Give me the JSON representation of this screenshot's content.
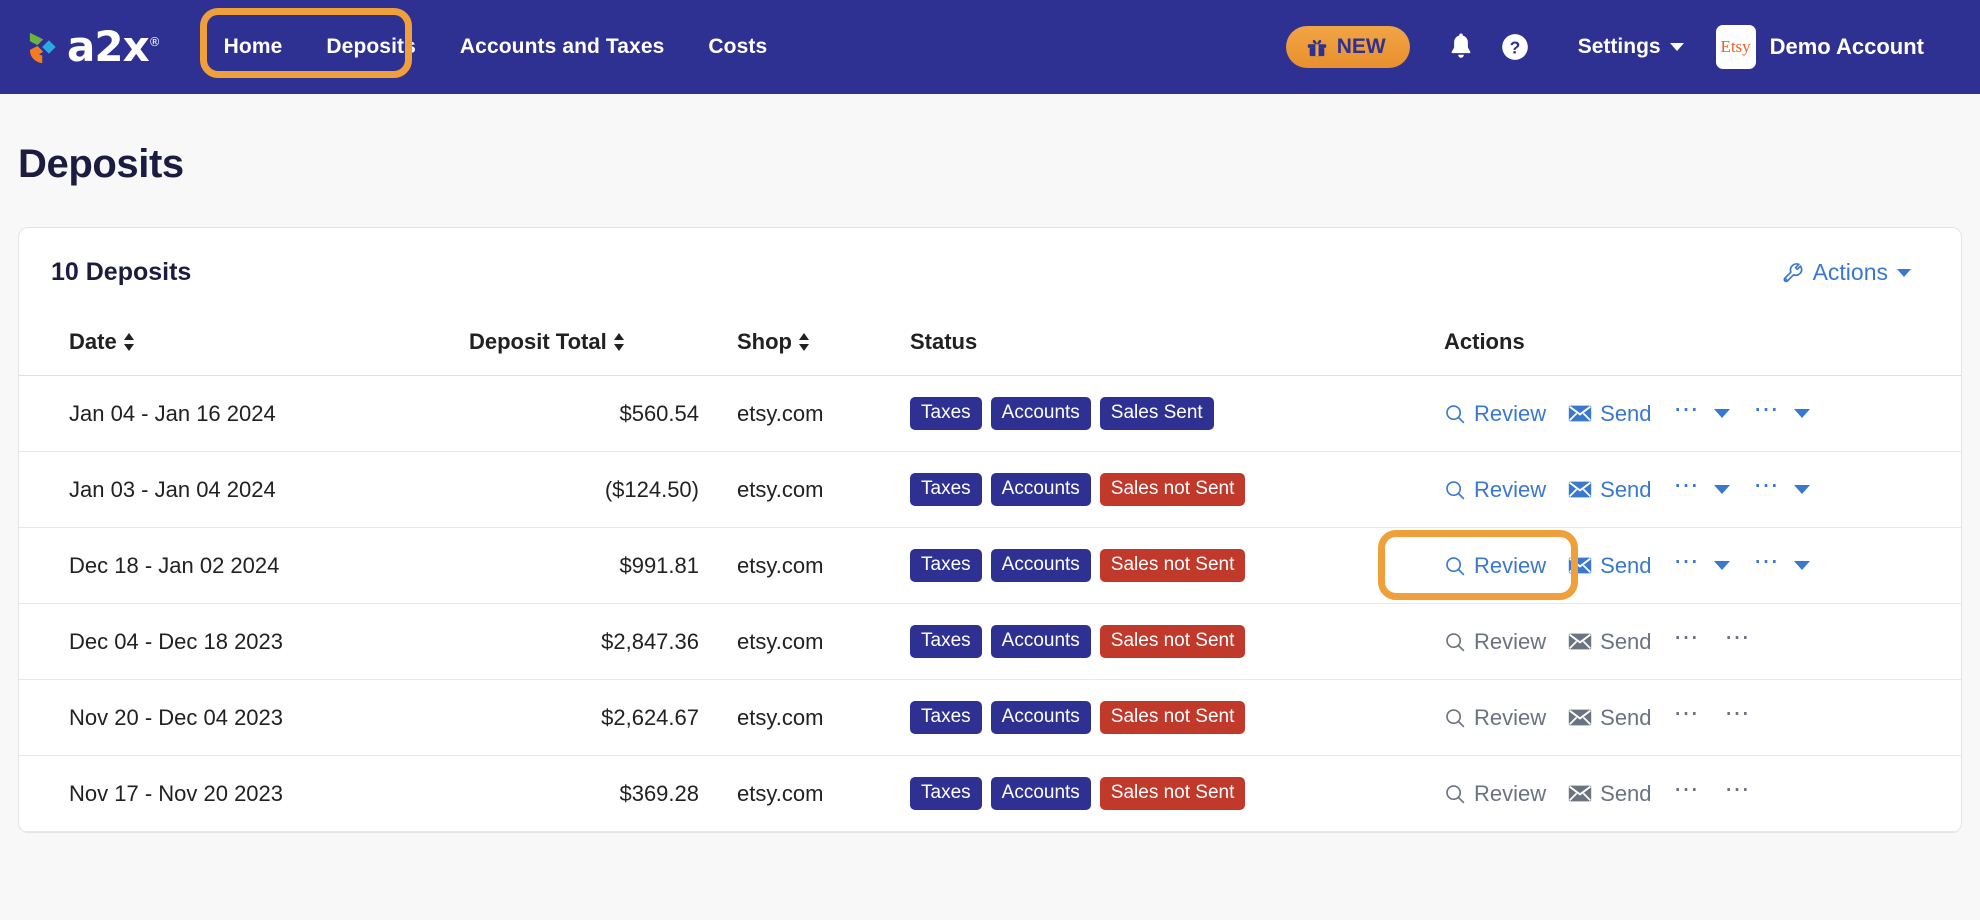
{
  "header": {
    "logo_text": "a2x",
    "logo_registered": "®",
    "nav_items": [
      {
        "label": "Home"
      },
      {
        "label": "Deposits"
      },
      {
        "label": "Accounts and Taxes"
      },
      {
        "label": "Costs"
      }
    ],
    "new_badge": {
      "label": "NEW",
      "icon": "gift-icon"
    },
    "bell_icon": "bell-icon",
    "help_icon": "question-circle-icon",
    "settings": {
      "label": "Settings",
      "caret": "chevron-down-icon"
    },
    "account": {
      "marketplace": "Etsy",
      "name": "Demo Account"
    }
  },
  "page": {
    "title": "Deposits"
  },
  "card": {
    "title": "10 Deposits",
    "actions_label": "Actions",
    "actions_icon": "wrench-icon"
  },
  "table": {
    "columns": [
      {
        "key": "date",
        "label": "Date",
        "sortable": true
      },
      {
        "key": "total",
        "label": "Deposit Total",
        "sortable": true
      },
      {
        "key": "shop",
        "label": "Shop",
        "sortable": true
      },
      {
        "key": "status",
        "label": "Status",
        "sortable": false
      },
      {
        "key": "actions",
        "label": "Actions",
        "sortable": false
      }
    ],
    "action_labels": {
      "review": "Review",
      "send": "Send",
      "review_icon": "magnifier-icon",
      "send_icon": "envelope-icon",
      "more_icon": "ellipsis-icon"
    },
    "rows": [
      {
        "date": "Jan 04 - Jan 16 2024",
        "total": "$560.54",
        "shop": "etsy.com",
        "badges": [
          {
            "label": "Taxes",
            "tone": "navy"
          },
          {
            "label": "Accounts",
            "tone": "navy"
          },
          {
            "label": "Sales Sent",
            "tone": "navy"
          }
        ],
        "enabled": true
      },
      {
        "date": "Jan 03 - Jan 04 2024",
        "total": "($124.50)",
        "shop": "etsy.com",
        "badges": [
          {
            "label": "Taxes",
            "tone": "navy"
          },
          {
            "label": "Accounts",
            "tone": "navy"
          },
          {
            "label": "Sales not Sent",
            "tone": "red"
          }
        ],
        "enabled": true
      },
      {
        "date": "Dec 18 - Jan 02 2024",
        "total": "$991.81",
        "shop": "etsy.com",
        "badges": [
          {
            "label": "Taxes",
            "tone": "navy"
          },
          {
            "label": "Accounts",
            "tone": "navy"
          },
          {
            "label": "Sales not Sent",
            "tone": "red"
          }
        ],
        "enabled": true
      },
      {
        "date": "Dec 04 - Dec 18 2023",
        "total": "$2,847.36",
        "shop": "etsy.com",
        "badges": [
          {
            "label": "Taxes",
            "tone": "navy"
          },
          {
            "label": "Accounts",
            "tone": "navy"
          },
          {
            "label": "Sales not Sent",
            "tone": "red"
          }
        ],
        "enabled": false
      },
      {
        "date": "Nov 20 - Dec 04 2023",
        "total": "$2,624.67",
        "shop": "etsy.com",
        "badges": [
          {
            "label": "Taxes",
            "tone": "navy"
          },
          {
            "label": "Accounts",
            "tone": "navy"
          },
          {
            "label": "Sales not Sent",
            "tone": "red"
          }
        ],
        "enabled": false
      },
      {
        "date": "Nov 17 - Nov 20 2023",
        "total": "$369.28",
        "shop": "etsy.com",
        "badges": [
          {
            "label": "Taxes",
            "tone": "navy"
          },
          {
            "label": "Accounts",
            "tone": "navy"
          },
          {
            "label": "Sales not Sent",
            "tone": "red"
          }
        ],
        "enabled": false
      }
    ]
  },
  "annotations": [
    {
      "target": "nav-deposits"
    },
    {
      "target": "row-2-review"
    }
  ],
  "colors": {
    "brand_navy": "#2e3191",
    "accent_orange": "#f0a03a",
    "link_blue": "#3a78d0",
    "badge_red": "#c0392b",
    "page_bg": "#f8f8f9"
  }
}
